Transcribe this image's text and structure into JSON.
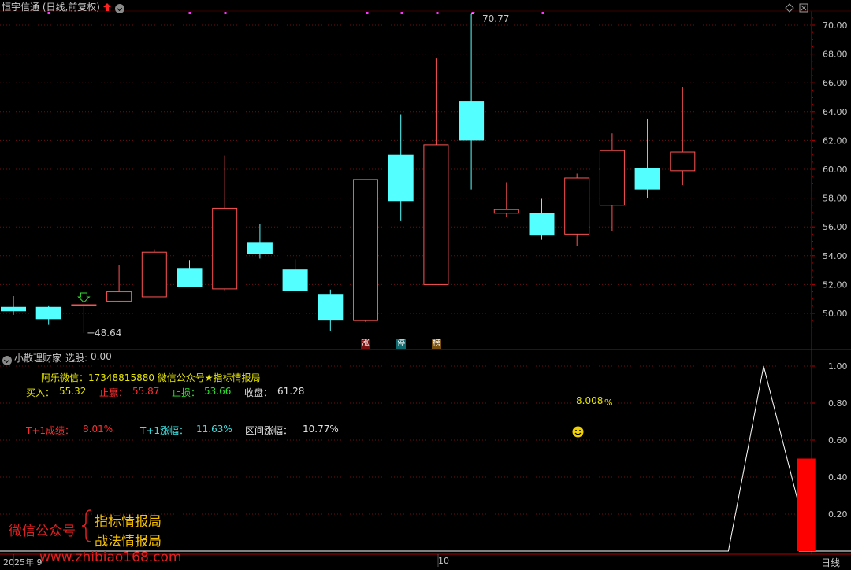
{
  "header": {
    "title": "恒宇信通 (日线,前复权)",
    "nav_icons": [
      "settings-icon",
      "close-icon"
    ]
  },
  "price_axis": {
    "ticks": [
      "70.00",
      "68.00",
      "66.00",
      "64.00",
      "62.00",
      "60.00",
      "58.00",
      "56.00",
      "54.00",
      "52.00",
      "50.00"
    ]
  },
  "chart_data": [
    {
      "type": "candlestick",
      "title": "恒宇信通 (日线,前复权)",
      "ylim": [
        48.5,
        71.0
      ],
      "colors": {
        "up": "#ff5555",
        "down": "#54ffff"
      },
      "candles": [
        {
          "open": 50.45,
          "close": 50.15,
          "high": 51.2,
          "low": 49.9
        },
        {
          "open": 50.45,
          "close": 49.6,
          "high": 50.5,
          "low": 49.2
        },
        {
          "open": 50.6,
          "close": 50.6,
          "high": 50.65,
          "low": 48.64
        },
        {
          "open": 50.85,
          "close": 51.5,
          "high": 53.35,
          "low": 50.8
        },
        {
          "open": 51.15,
          "close": 54.25,
          "high": 54.45,
          "low": 51.15
        },
        {
          "open": 53.1,
          "close": 51.85,
          "high": 53.7,
          "low": 51.85
        },
        {
          "open": 51.7,
          "close": 57.3,
          "high": 60.95,
          "low": 51.6
        },
        {
          "open": 54.9,
          "close": 54.1,
          "high": 56.2,
          "low": 53.8
        },
        {
          "open": 53.05,
          "close": 51.55,
          "high": 53.75,
          "low": 51.55
        },
        {
          "open": 51.3,
          "close": 49.5,
          "high": 51.65,
          "low": 48.8
        },
        {
          "open": 49.5,
          "close": 59.3,
          "high": 59.3,
          "low": 49.4
        },
        {
          "open": 61.0,
          "close": 57.8,
          "high": 63.8,
          "low": 56.4
        },
        {
          "open": 52.0,
          "close": 61.7,
          "high": 67.7,
          "low": 52.0
        },
        {
          "open": 64.75,
          "close": 62.0,
          "high": 70.77,
          "low": 58.6
        },
        {
          "open": 56.95,
          "close": 57.2,
          "high": 59.1,
          "low": 56.7
        },
        {
          "open": 56.95,
          "close": 55.4,
          "high": 57.95,
          "low": 55.1
        },
        {
          "open": 55.5,
          "close": 59.4,
          "high": 59.7,
          "low": 54.7
        },
        {
          "open": 57.5,
          "close": 61.3,
          "high": 62.5,
          "low": 55.7
        },
        {
          "open": 60.1,
          "close": 58.6,
          "high": 63.5,
          "low": 58.0
        },
        {
          "open": 59.9,
          "close": 61.2,
          "high": 65.7,
          "low": 58.9
        }
      ],
      "annotations": {
        "high": "70.77",
        "low": "48.64"
      }
    },
    {
      "type": "line",
      "title": "小散理财家 选股: 0.00",
      "ylim": [
        0,
        1.1
      ],
      "ticks": [
        "1.00",
        "0.80",
        "0.60",
        "0.40",
        "0.20"
      ],
      "x_range": [
        0,
        27.5
      ],
      "line_points": [
        [
          0,
          0
        ],
        [
          20.3,
          0
        ],
        [
          21.3,
          1.0
        ],
        [
          22.3,
          0.25
        ]
      ],
      "bar": {
        "x": 22.5,
        "value": 0.5
      }
    }
  ],
  "indicator": {
    "name_label": "小散理财家",
    "select_label": "选股:",
    "select_value": "0.00",
    "contact_line": "阿乐微信：17348815880     微信公众号★指标情报局",
    "buy_label": "买入：",
    "buy_value": "55.32",
    "take_profit_label": "止赢：",
    "take_profit_value": "55.87",
    "stop_loss_label": "止损：",
    "stop_loss_value": "53.66",
    "close_label": "收盘：",
    "close_value": "61.28",
    "t1_result_label": "T+1成绩：",
    "t1_result_value": "8.01%",
    "t1_gain_label": "T+1涨幅：",
    "t1_gain_value": "11.63%",
    "range_gain_label": "区间涨幅：",
    "range_gain_value": "10.77%",
    "percent_value": "8.008",
    "percent_unit": "%"
  },
  "watermark": {
    "left_text": "微信公众号",
    "right_line1": "指标情报局",
    "right_line2": "战法情报局",
    "site": "www.zhibiao168.com"
  },
  "time_axis": {
    "labels": [
      "2025年 9",
      "10"
    ],
    "period_tab": "日线"
  },
  "signal_tags": [
    "涨",
    "停",
    "榜"
  ],
  "colors": {
    "up": "#ff5555",
    "down": "#54ffff",
    "axis": "#b30000",
    "grid": "#6b1010",
    "marker": "#ff33ff",
    "signal_line": "#ffffff",
    "signal_bar": "#ff0000"
  }
}
